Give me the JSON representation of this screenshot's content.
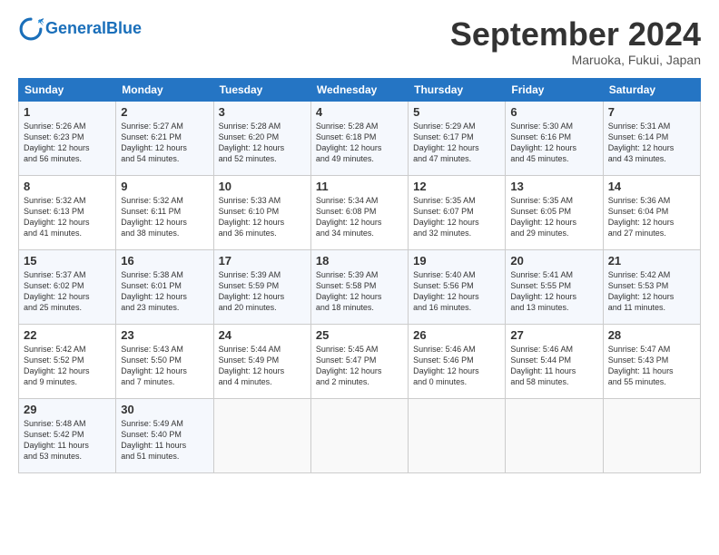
{
  "header": {
    "logo_general": "General",
    "logo_blue": "Blue",
    "month": "September 2024",
    "location": "Maruoka, Fukui, Japan"
  },
  "days": [
    "Sunday",
    "Monday",
    "Tuesday",
    "Wednesday",
    "Thursday",
    "Friday",
    "Saturday"
  ],
  "weeks": [
    [
      {
        "num": "1",
        "lines": [
          "Sunrise: 5:26 AM",
          "Sunset: 6:23 PM",
          "Daylight: 12 hours",
          "and 56 minutes."
        ]
      },
      {
        "num": "2",
        "lines": [
          "Sunrise: 5:27 AM",
          "Sunset: 6:21 PM",
          "Daylight: 12 hours",
          "and 54 minutes."
        ]
      },
      {
        "num": "3",
        "lines": [
          "Sunrise: 5:28 AM",
          "Sunset: 6:20 PM",
          "Daylight: 12 hours",
          "and 52 minutes."
        ]
      },
      {
        "num": "4",
        "lines": [
          "Sunrise: 5:28 AM",
          "Sunset: 6:18 PM",
          "Daylight: 12 hours",
          "and 49 minutes."
        ]
      },
      {
        "num": "5",
        "lines": [
          "Sunrise: 5:29 AM",
          "Sunset: 6:17 PM",
          "Daylight: 12 hours",
          "and 47 minutes."
        ]
      },
      {
        "num": "6",
        "lines": [
          "Sunrise: 5:30 AM",
          "Sunset: 6:16 PM",
          "Daylight: 12 hours",
          "and 45 minutes."
        ]
      },
      {
        "num": "7",
        "lines": [
          "Sunrise: 5:31 AM",
          "Sunset: 6:14 PM",
          "Daylight: 12 hours",
          "and 43 minutes."
        ]
      }
    ],
    [
      {
        "num": "8",
        "lines": [
          "Sunrise: 5:32 AM",
          "Sunset: 6:13 PM",
          "Daylight: 12 hours",
          "and 41 minutes."
        ]
      },
      {
        "num": "9",
        "lines": [
          "Sunrise: 5:32 AM",
          "Sunset: 6:11 PM",
          "Daylight: 12 hours",
          "and 38 minutes."
        ]
      },
      {
        "num": "10",
        "lines": [
          "Sunrise: 5:33 AM",
          "Sunset: 6:10 PM",
          "Daylight: 12 hours",
          "and 36 minutes."
        ]
      },
      {
        "num": "11",
        "lines": [
          "Sunrise: 5:34 AM",
          "Sunset: 6:08 PM",
          "Daylight: 12 hours",
          "and 34 minutes."
        ]
      },
      {
        "num": "12",
        "lines": [
          "Sunrise: 5:35 AM",
          "Sunset: 6:07 PM",
          "Daylight: 12 hours",
          "and 32 minutes."
        ]
      },
      {
        "num": "13",
        "lines": [
          "Sunrise: 5:35 AM",
          "Sunset: 6:05 PM",
          "Daylight: 12 hours",
          "and 29 minutes."
        ]
      },
      {
        "num": "14",
        "lines": [
          "Sunrise: 5:36 AM",
          "Sunset: 6:04 PM",
          "Daylight: 12 hours",
          "and 27 minutes."
        ]
      }
    ],
    [
      {
        "num": "15",
        "lines": [
          "Sunrise: 5:37 AM",
          "Sunset: 6:02 PM",
          "Daylight: 12 hours",
          "and 25 minutes."
        ]
      },
      {
        "num": "16",
        "lines": [
          "Sunrise: 5:38 AM",
          "Sunset: 6:01 PM",
          "Daylight: 12 hours",
          "and 23 minutes."
        ]
      },
      {
        "num": "17",
        "lines": [
          "Sunrise: 5:39 AM",
          "Sunset: 5:59 PM",
          "Daylight: 12 hours",
          "and 20 minutes."
        ]
      },
      {
        "num": "18",
        "lines": [
          "Sunrise: 5:39 AM",
          "Sunset: 5:58 PM",
          "Daylight: 12 hours",
          "and 18 minutes."
        ]
      },
      {
        "num": "19",
        "lines": [
          "Sunrise: 5:40 AM",
          "Sunset: 5:56 PM",
          "Daylight: 12 hours",
          "and 16 minutes."
        ]
      },
      {
        "num": "20",
        "lines": [
          "Sunrise: 5:41 AM",
          "Sunset: 5:55 PM",
          "Daylight: 12 hours",
          "and 13 minutes."
        ]
      },
      {
        "num": "21",
        "lines": [
          "Sunrise: 5:42 AM",
          "Sunset: 5:53 PM",
          "Daylight: 12 hours",
          "and 11 minutes."
        ]
      }
    ],
    [
      {
        "num": "22",
        "lines": [
          "Sunrise: 5:42 AM",
          "Sunset: 5:52 PM",
          "Daylight: 12 hours",
          "and 9 minutes."
        ]
      },
      {
        "num": "23",
        "lines": [
          "Sunrise: 5:43 AM",
          "Sunset: 5:50 PM",
          "Daylight: 12 hours",
          "and 7 minutes."
        ]
      },
      {
        "num": "24",
        "lines": [
          "Sunrise: 5:44 AM",
          "Sunset: 5:49 PM",
          "Daylight: 12 hours",
          "and 4 minutes."
        ]
      },
      {
        "num": "25",
        "lines": [
          "Sunrise: 5:45 AM",
          "Sunset: 5:47 PM",
          "Daylight: 12 hours",
          "and 2 minutes."
        ]
      },
      {
        "num": "26",
        "lines": [
          "Sunrise: 5:46 AM",
          "Sunset: 5:46 PM",
          "Daylight: 12 hours",
          "and 0 minutes."
        ]
      },
      {
        "num": "27",
        "lines": [
          "Sunrise: 5:46 AM",
          "Sunset: 5:44 PM",
          "Daylight: 11 hours",
          "and 58 minutes."
        ]
      },
      {
        "num": "28",
        "lines": [
          "Sunrise: 5:47 AM",
          "Sunset: 5:43 PM",
          "Daylight: 11 hours",
          "and 55 minutes."
        ]
      }
    ],
    [
      {
        "num": "29",
        "lines": [
          "Sunrise: 5:48 AM",
          "Sunset: 5:42 PM",
          "Daylight: 11 hours",
          "and 53 minutes."
        ]
      },
      {
        "num": "30",
        "lines": [
          "Sunrise: 5:49 AM",
          "Sunset: 5:40 PM",
          "Daylight: 11 hours",
          "and 51 minutes."
        ]
      },
      null,
      null,
      null,
      null,
      null
    ]
  ]
}
